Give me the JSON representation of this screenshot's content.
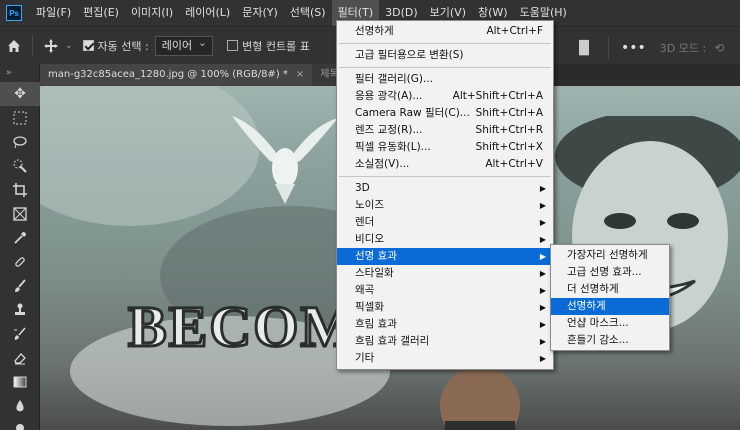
{
  "menubar": {
    "logo": "Ps",
    "items": [
      "파일(F)",
      "편집(E)",
      "이미지(I)",
      "레이어(L)",
      "문자(Y)",
      "선택(S)",
      "필터(T)",
      "3D(D)",
      "보기(V)",
      "창(W)",
      "도움말(H)"
    ],
    "active_index": 6
  },
  "options": {
    "auto_select_label": "자동 선택 :",
    "auto_select_value": "레이어",
    "transform_controls_label": "변형 컨트롤 표",
    "mode_3d_label": "3D 모드 :"
  },
  "tabs": [
    {
      "label": "man-g32c85acea_1280.jpg @ 100% (RGB/8#) *",
      "close": "×"
    },
    {
      "label": "제목"
    }
  ],
  "filter_menu": {
    "groups": [
      [
        {
          "label": "선명하게",
          "shortcut": "Alt+Ctrl+F"
        }
      ],
      [
        {
          "label": "고급 필터용으로 변환(S)",
          "shortcut": ""
        }
      ],
      [
        {
          "label": "필터 갤러리(G)...",
          "shortcut": ""
        },
        {
          "label": "응용 광각(A)...",
          "shortcut": "Alt+Shift+Ctrl+A"
        },
        {
          "label": "Camera Raw 필터(C)...",
          "shortcut": "Shift+Ctrl+A"
        },
        {
          "label": "렌즈 교정(R)...",
          "shortcut": "Shift+Ctrl+R"
        },
        {
          "label": "픽셀 유동화(L)...",
          "shortcut": "Shift+Ctrl+X"
        },
        {
          "label": "소실점(V)...",
          "shortcut": "Alt+Ctrl+V"
        }
      ],
      [
        {
          "label": "3D",
          "submenu": true
        },
        {
          "label": "노이즈",
          "submenu": true
        },
        {
          "label": "렌더",
          "submenu": true
        },
        {
          "label": "비디오",
          "submenu": true
        },
        {
          "label": "선명 효과",
          "submenu": true,
          "highlight": true
        },
        {
          "label": "스타일화",
          "submenu": true
        },
        {
          "label": "왜곡",
          "submenu": true
        },
        {
          "label": "픽셀화",
          "submenu": true
        },
        {
          "label": "흐림 효과",
          "submenu": true
        },
        {
          "label": "흐림 효과 갤러리",
          "submenu": true
        },
        {
          "label": "기타",
          "submenu": true
        }
      ]
    ]
  },
  "sharpen_menu": {
    "items": [
      {
        "label": "가장자리 선명하게"
      },
      {
        "label": "고급 선명 효과..."
      },
      {
        "label": "더 선명하게"
      },
      {
        "label": "선명하게",
        "highlight": true
      },
      {
        "label": "언샵 마스크..."
      },
      {
        "label": "흔들기 감소..."
      }
    ]
  },
  "canvas_text": "BECOME",
  "colors": {
    "highlight": "#0a6ad6",
    "menu_bg": "#f2f2f2",
    "ui_bg": "#323232"
  }
}
